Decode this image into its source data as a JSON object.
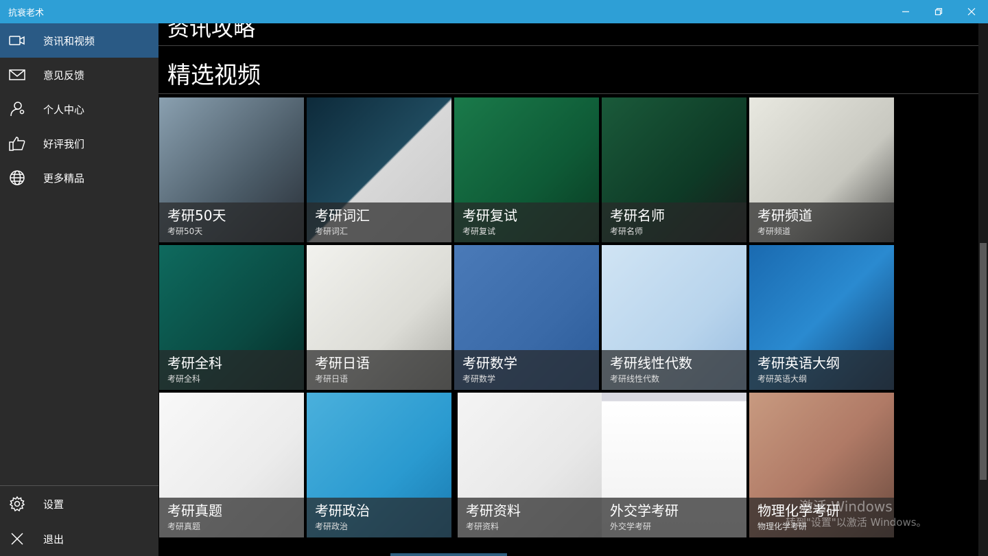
{
  "window": {
    "title": "抗衰老术"
  },
  "sidebar": {
    "items": [
      {
        "label": "资讯和视频",
        "icon": "video-icon"
      },
      {
        "label": "意见反馈",
        "icon": "mail-icon"
      },
      {
        "label": "个人中心",
        "icon": "person-icon"
      },
      {
        "label": "好评我们",
        "icon": "thumbs-up-icon"
      },
      {
        "label": "更多精品",
        "icon": "globe-icon"
      }
    ],
    "bottom": [
      {
        "label": "设置",
        "icon": "gear-icon"
      },
      {
        "label": "退出",
        "icon": "close-icon"
      }
    ]
  },
  "main": {
    "previous_section": "资讯攻略",
    "section_title": "精选视频",
    "tiles": [
      {
        "title": "考研50天",
        "subtitle": "考研50天"
      },
      {
        "title": "考研词汇",
        "subtitle": "考研词汇"
      },
      {
        "title": "考研复试",
        "subtitle": "考研复试"
      },
      {
        "title": "考研名师",
        "subtitle": "考研名师"
      },
      {
        "title": "考研频道",
        "subtitle": "考研频道"
      },
      {
        "title": "考研全科",
        "subtitle": "考研全科"
      },
      {
        "title": "考研日语",
        "subtitle": "考研日语"
      },
      {
        "title": "考研数学",
        "subtitle": "考研数学"
      },
      {
        "title": "考研线性代数",
        "subtitle": "考研线性代数"
      },
      {
        "title": "考研英语大纲",
        "subtitle": "考研英语大纲"
      },
      {
        "title": "考研真题",
        "subtitle": "考研真题"
      },
      {
        "title": "考研政治",
        "subtitle": "考研政治"
      },
      {
        "title": "考研资料",
        "subtitle": "考研资料"
      },
      {
        "title": "外交学考研",
        "subtitle": "外交学考研"
      },
      {
        "title": "物理化学考研",
        "subtitle": "物理化学考研"
      }
    ]
  },
  "watermark": {
    "line1": "激活 Windows",
    "line2": "转到\"设置\"以激活 Windows。"
  },
  "colors": {
    "titlebar": "#2e9fd6",
    "sidebar": "#2b2b2b",
    "active": "#2a5a85"
  }
}
